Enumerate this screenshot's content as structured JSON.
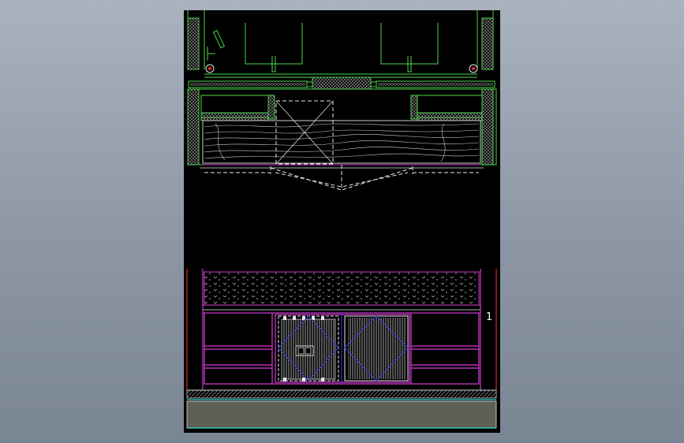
{
  "canvas": {
    "background_color": "#97a1ae",
    "sheet_color": "#000000"
  },
  "drawing": {
    "section_label": "1",
    "colors": {
      "outline_green": "#4cd64c",
      "hatch_gray": "#9a9a9a",
      "magenta": "#d23cd2",
      "red": "#d42a2a",
      "blue": "#3a3ad8",
      "cyan": "#3ad8d8",
      "white": "#e6e6e6",
      "floor_fill": "#5f5f55"
    }
  }
}
